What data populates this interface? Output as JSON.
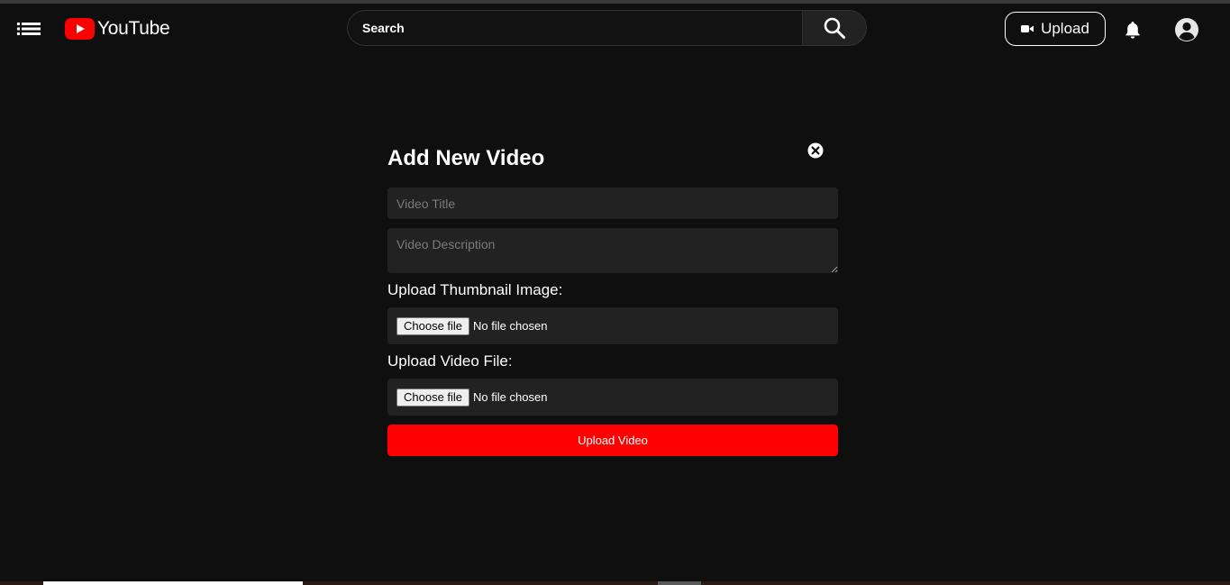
{
  "header": {
    "logo_text": "YouTube",
    "search_placeholder": "Search",
    "upload_label": "Upload"
  },
  "modal": {
    "title": "Add New Video",
    "video_title_placeholder": "Video Title",
    "video_description_placeholder": "Video Description",
    "thumbnail_label": "Upload Thumbnail Image:",
    "video_file_label": "Upload Video File:",
    "choose_file_label": "Choose file",
    "no_file_text": "No file chosen",
    "submit_label": "Upload Video"
  },
  "colors": {
    "brand_red": "#ff0000",
    "background": "#0f0f0f",
    "field_bg": "#222222"
  },
  "icons": {
    "menu": "menu-icon",
    "logo": "youtube-logo-icon",
    "search": "search-icon",
    "camera": "video-camera-icon",
    "bell": "bell-icon",
    "avatar": "account-icon",
    "close": "close-icon"
  }
}
